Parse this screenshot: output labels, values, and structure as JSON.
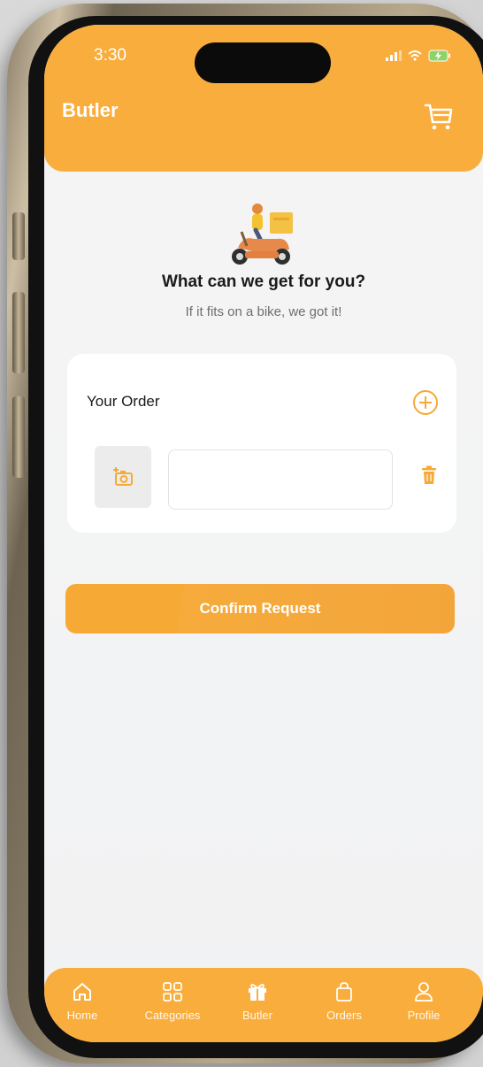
{
  "status_bar": {
    "time": "3:30"
  },
  "header": {
    "title": "Butler",
    "cart_icon": "cart-icon"
  },
  "hero": {
    "title": "What can we get for you?",
    "subtitle": "If it fits on a bike, we got it!"
  },
  "order_card": {
    "title": "Your Order",
    "item_input": {
      "value": "",
      "placeholder": ""
    }
  },
  "confirm_label": "Confirm Request",
  "tabbar": {
    "items": [
      {
        "label": "Home",
        "icon": "home-icon"
      },
      {
        "label": "Categories",
        "icon": "grid-icon"
      },
      {
        "label": "Butler",
        "icon": "gift-icon"
      },
      {
        "label": "Orders",
        "icon": "bag-icon"
      },
      {
        "label": "Profile",
        "icon": "profile-icon"
      }
    ]
  },
  "colors": {
    "accent": "#f9ad3d",
    "background": "#f3f3f3"
  }
}
